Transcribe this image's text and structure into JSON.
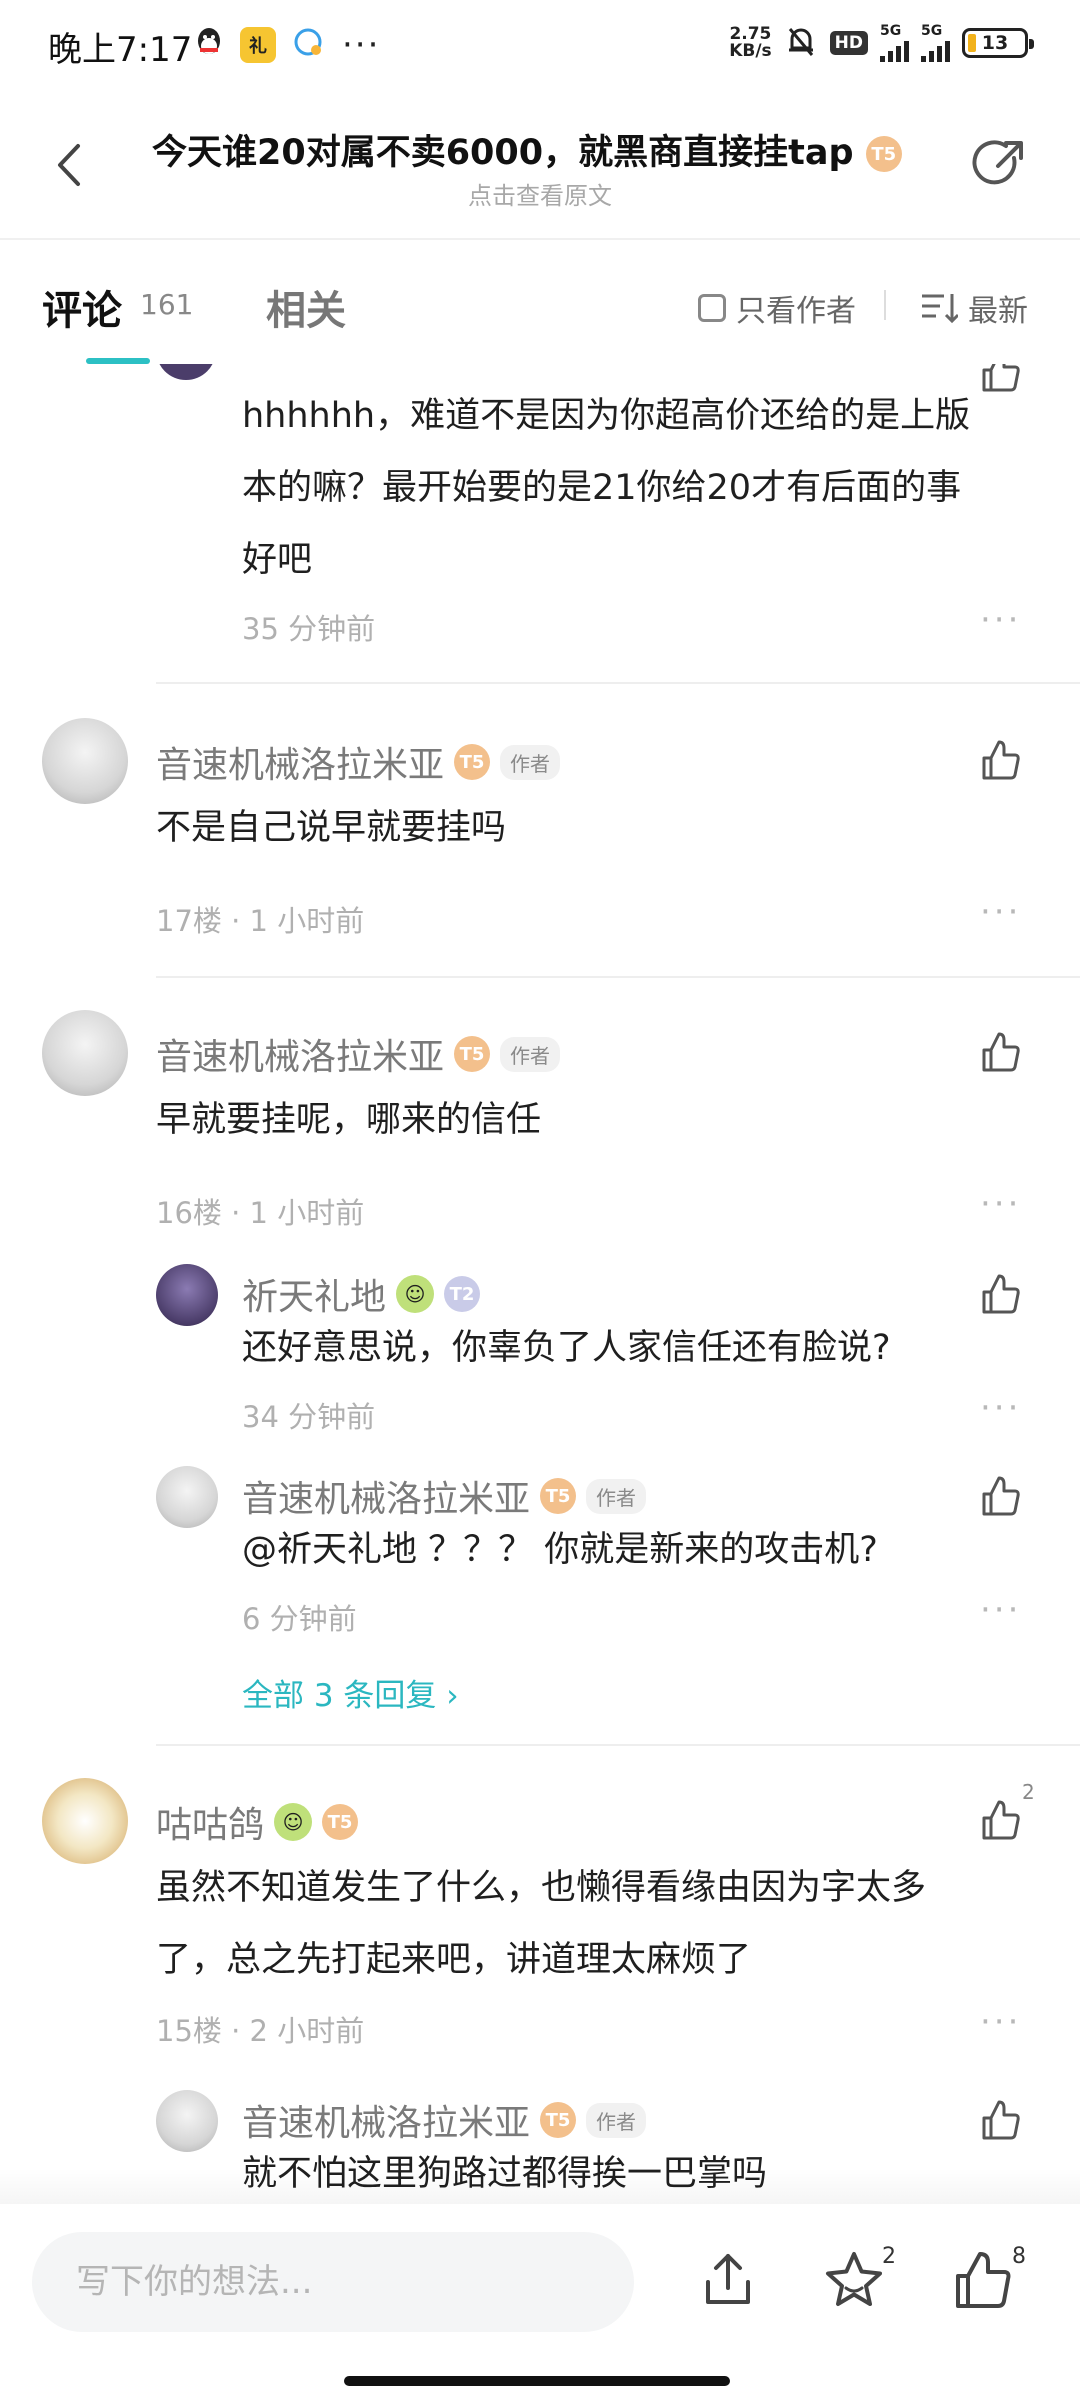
{
  "status_bar": {
    "time": "晚上7:17",
    "dots": "···",
    "net_speed_value": "2.75",
    "net_speed_unit": "KB/s",
    "hd_label": "HD",
    "sim1_label": "5G",
    "sim2_label": "5G",
    "battery_level": "13",
    "colors": {
      "battery_fill": "#f2b21b"
    }
  },
  "header": {
    "title": "今天谁20对属不卖6000，就黑商直接挂tap",
    "subtitle": "点击查看原文",
    "title_badge": "T5"
  },
  "tabs": {
    "comments_label": "评论",
    "comments_count": "161",
    "related_label": "相关",
    "author_only_label": "只看作者",
    "sort_label": "最新",
    "accent_color": "#2cc0c4"
  },
  "comments": [
    {
      "kind": "reply-partial",
      "text_line1": "hhhhhh，难道不是因为你超高价还给的是上版",
      "text_line2": "本的嘛？最开始要的是21你给20才有后面的事",
      "text_line3": "好吧",
      "meta": "35 分钟前"
    },
    {
      "kind": "comment",
      "username": "音速机械洛拉米亚",
      "level_badge": "T5",
      "author_tag": "作者",
      "text": "不是自己说早就要挂吗",
      "meta": "17楼 · 1 小时前"
    },
    {
      "kind": "comment",
      "username": "音速机械洛拉米亚",
      "level_badge": "T5",
      "author_tag": "作者",
      "text": "早就要挂呢，哪来的信任",
      "meta": "16楼 · 1 小时前",
      "replies": [
        {
          "username": "祈天礼地",
          "level_badge": "T2",
          "text": "还好意思说，你辜负了人家信任还有脸说?",
          "meta": "34 分钟前"
        },
        {
          "username": "音速机械洛拉米亚",
          "level_badge": "T5",
          "author_tag": "作者",
          "text": "@祈天礼地 ？？？ 你就是新来的攻击机?",
          "meta": "6 分钟前"
        }
      ],
      "all_replies_label": "全部 3 条回复 ›"
    },
    {
      "kind": "comment",
      "username": "咕咕鸽",
      "level_badge": "T5",
      "text_line1": "虽然不知道发生了什么，也懒得看缘由因为字太多",
      "text_line2": "了，总之先打起来吧，讲道理太麻烦了",
      "meta": "15楼 · 2 小时前",
      "like_count": "2",
      "replies": [
        {
          "username": "音速机械洛拉米亚",
          "level_badge": "T5",
          "author_tag": "作者",
          "text": "就不怕这里狗路过都得挨一巴掌吗"
        }
      ]
    }
  ],
  "bottom_bar": {
    "input_placeholder": "写下你的想法...",
    "favorite_count": "2",
    "like_count": "8"
  }
}
